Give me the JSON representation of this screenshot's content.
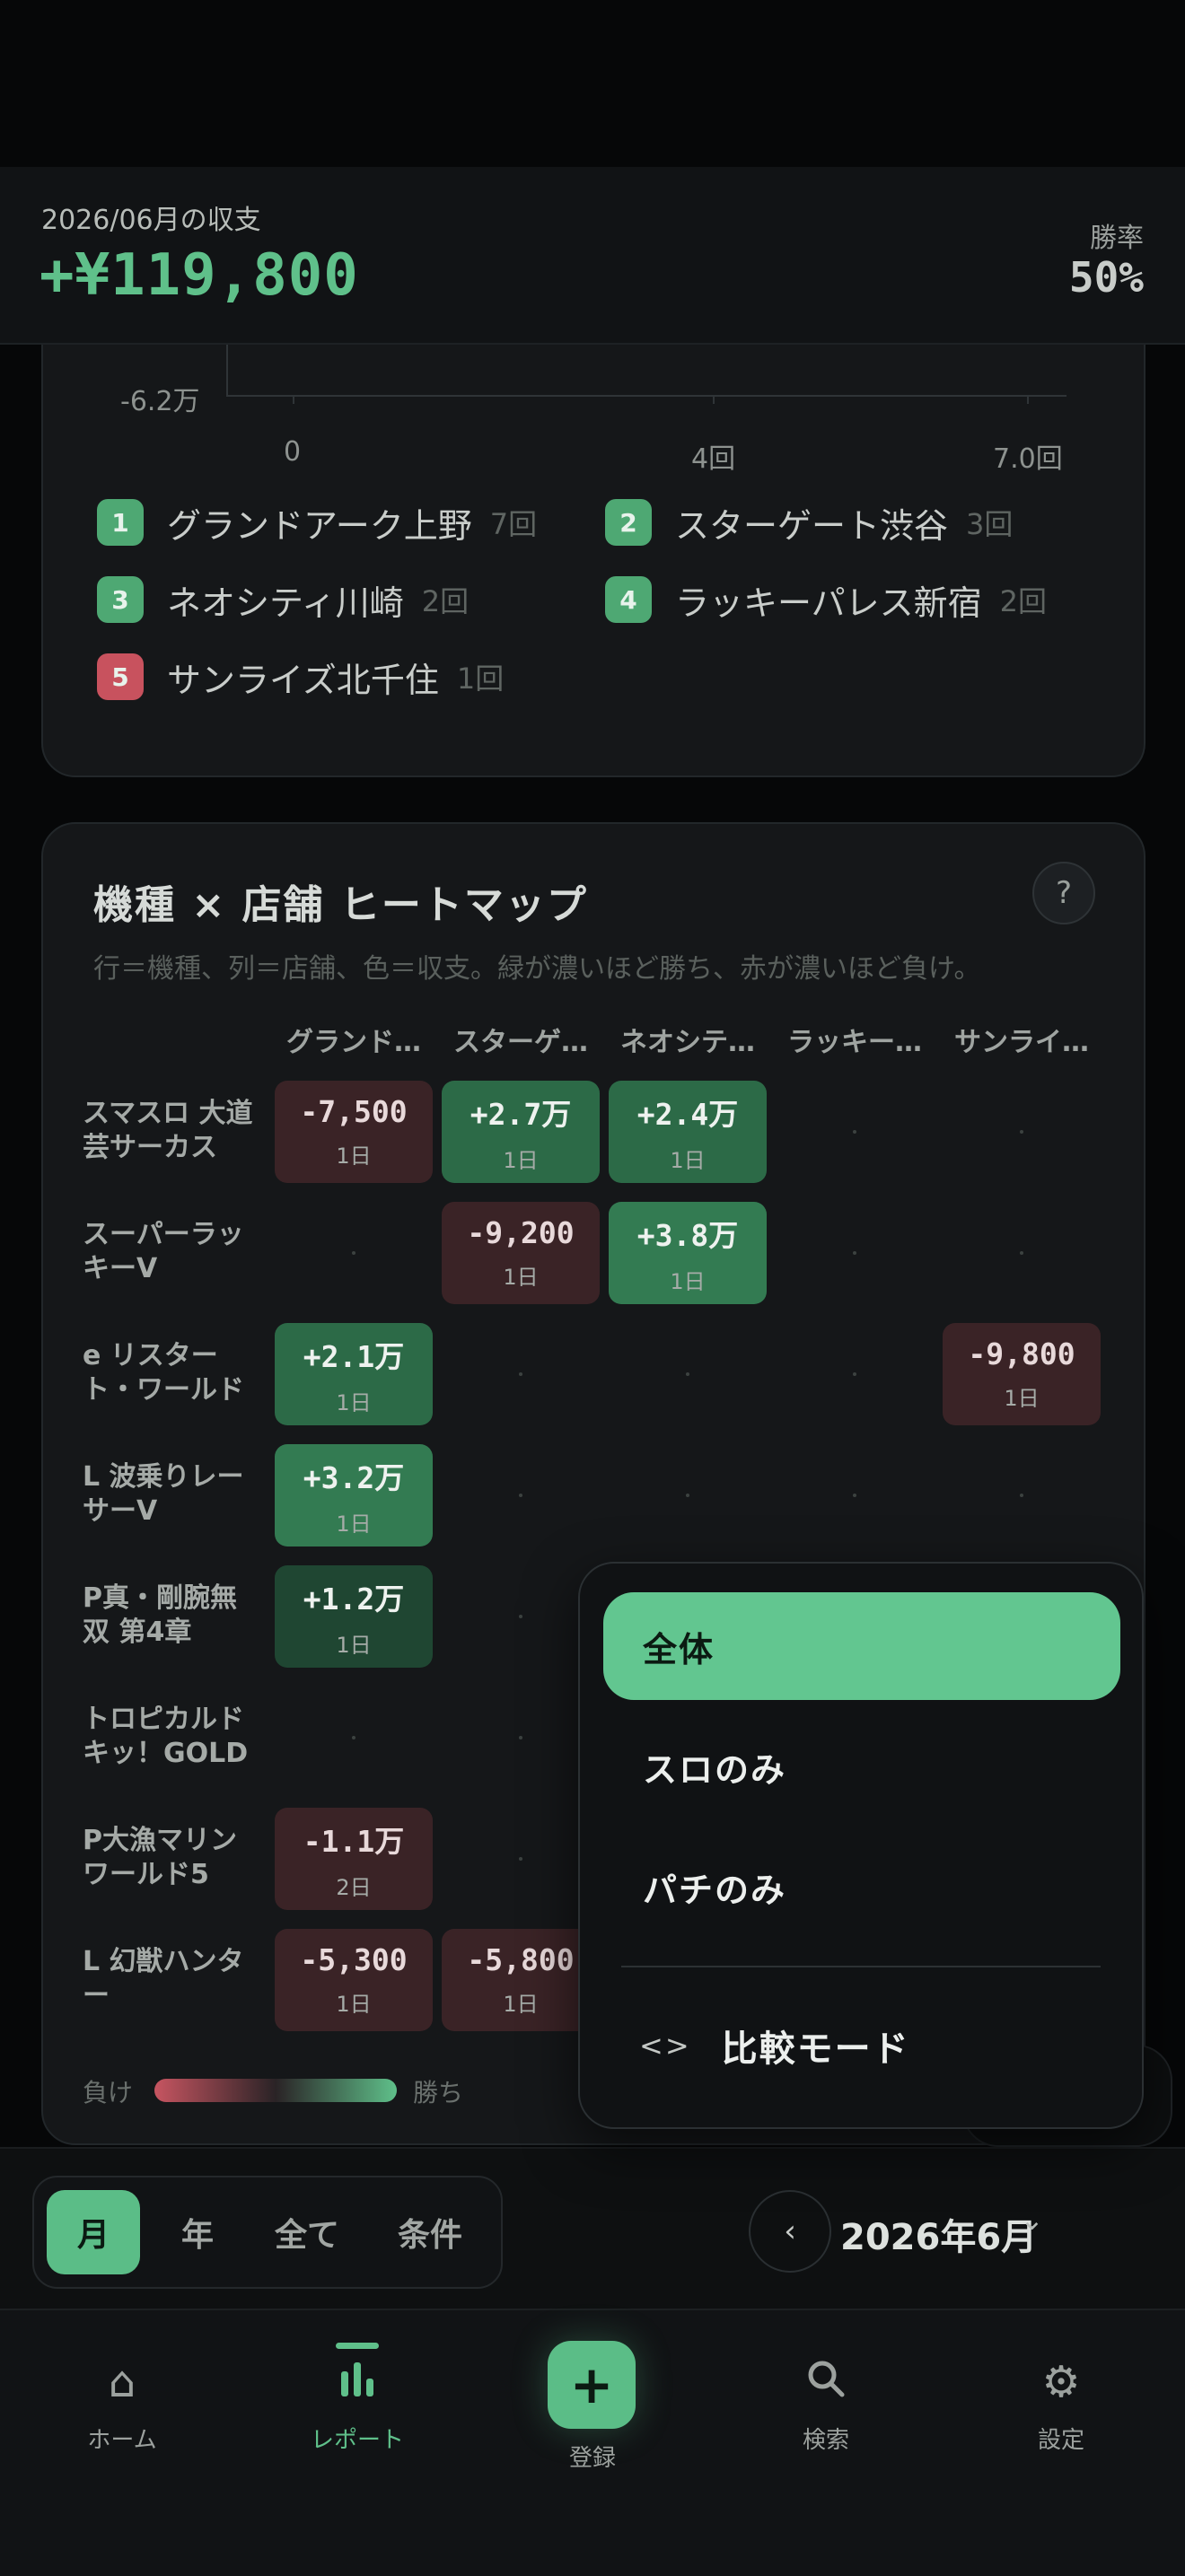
{
  "summary": {
    "period_label": "2026/06月の収支",
    "total": "+¥119,800",
    "win_rate_label": "勝率",
    "win_rate": "50%"
  },
  "store_chart": {
    "y_tick": "-6.2万",
    "x_ticks": [
      "0",
      "4回",
      "7.0回"
    ]
  },
  "store_ranking": [
    {
      "rank": "1",
      "name": "グランドアーク上野",
      "count": "7回",
      "color": "#4ea873"
    },
    {
      "rank": "2",
      "name": "スターゲート渋谷",
      "count": "3回",
      "color": "#4ea873"
    },
    {
      "rank": "3",
      "name": "ネオシティ川崎",
      "count": "2回",
      "color": "#4ea873"
    },
    {
      "rank": "4",
      "name": "ラッキーパレス新宿",
      "count": "2回",
      "color": "#4ea873"
    },
    {
      "rank": "5",
      "name": "サンライズ北千住",
      "count": "1回",
      "color": "#c8525e"
    }
  ],
  "heatmap": {
    "title": "機種 × 店舗 ヒートマップ",
    "help": "?",
    "subtitle": "行＝機種、列＝店舗、色＝収支。緑が濃いほど勝ち、赤が濃いほど負け。",
    "columns": [
      "グランド…",
      "スターゲ…",
      "ネオシテ…",
      "ラッキー…",
      "サンライ…"
    ],
    "rows": [
      {
        "name": "スマスロ 大道芸サーカス",
        "cells": [
          {
            "v": "-7,500",
            "d": "1日",
            "t": "neg"
          },
          {
            "v": "+2.7万",
            "d": "1日",
            "t": "pos2"
          },
          {
            "v": "+2.4万",
            "d": "1日",
            "t": "pos2"
          },
          null,
          null
        ]
      },
      {
        "name": "スーパーラッキーV",
        "cells": [
          null,
          {
            "v": "-9,200",
            "d": "1日",
            "t": "neg"
          },
          {
            "v": "+3.8万",
            "d": "1日",
            "t": "pos3"
          },
          null,
          null
        ]
      },
      {
        "name": "e リスタート・ワールド",
        "cells": [
          {
            "v": "+2.1万",
            "d": "1日",
            "t": "pos2"
          },
          null,
          null,
          null,
          {
            "v": "-9,800",
            "d": "1日",
            "t": "neg"
          }
        ]
      },
      {
        "name": "L 波乗りレーサーV",
        "cells": [
          {
            "v": "+3.2万",
            "d": "1日",
            "t": "pos3"
          },
          null,
          null,
          null,
          null
        ]
      },
      {
        "name": "P真・剛腕無双 第4章",
        "cells": [
          {
            "v": "+1.2万",
            "d": "1日",
            "t": "pos1"
          },
          null,
          null,
          null,
          null
        ]
      },
      {
        "name": "トロピカルドキッ！GOLD",
        "cells": [
          null,
          null,
          null,
          null,
          null
        ]
      },
      {
        "name": "P大漁マリンワールド5",
        "cells": [
          {
            "v": "-1.1万",
            "d": "2日",
            "t": "neg"
          },
          null,
          null,
          null,
          null
        ]
      },
      {
        "name": "L 幻獣ハンター",
        "cells": [
          {
            "v": "-5,300",
            "d": "1日",
            "t": "neg"
          },
          {
            "v": "-5,800",
            "d": "1日",
            "t": "neg"
          },
          null,
          null,
          null
        ]
      }
    ],
    "legend_lose": "負け",
    "legend_win": "勝ち"
  },
  "filter_menu": {
    "items": [
      "全体",
      "スロのみ",
      "パチのみ"
    ],
    "selected": "全体",
    "compare_icon": "<>",
    "compare_label": "比較モード"
  },
  "ghost_chip": {
    "label": "全体"
  },
  "period_bar": {
    "segments": [
      "月",
      "年",
      "全て",
      "条件"
    ],
    "active_segment": "月",
    "prev_icon": "‹",
    "label": "2026年6月",
    "caret": "⌄"
  },
  "tabbar": {
    "tabs": [
      {
        "name": "home",
        "label": "ホーム",
        "icon": "⌂"
      },
      {
        "name": "report",
        "label": "レポート",
        "icon": "▮▮▮"
      },
      {
        "name": "register",
        "label": "登録",
        "icon": "+"
      },
      {
        "name": "search",
        "label": "検索",
        "icon": "⚲"
      },
      {
        "name": "settings",
        "label": "設定",
        "icon": "⚙"
      }
    ],
    "active": "report"
  }
}
